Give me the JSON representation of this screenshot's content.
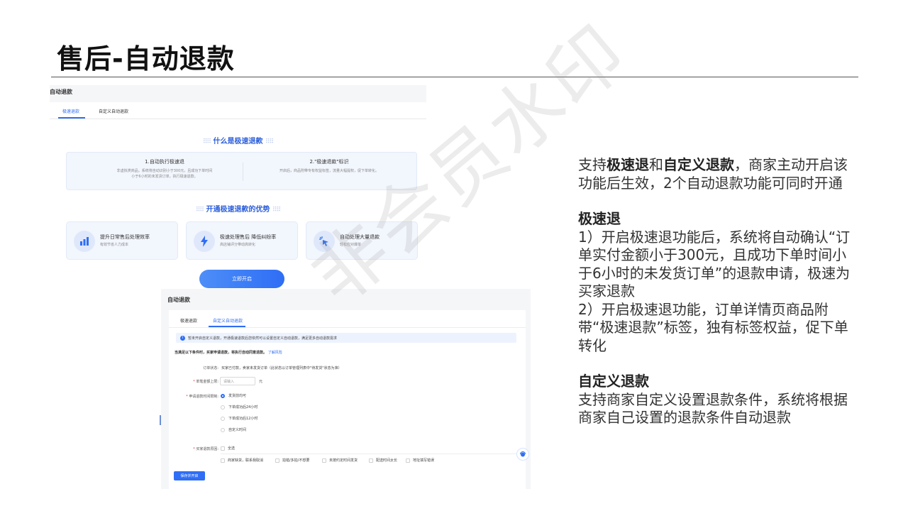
{
  "slide": {
    "title": "售后-自动退款"
  },
  "shot1": {
    "title": "自动退款",
    "tabs": [
      "极速退款",
      "自定义自动退款"
    ],
    "what_is": "什么是极速退款",
    "items": [
      {
        "title": "1.自动执行极速退",
        "desc1": "非虚拟类商品，系统将自动识别小于300元，且成功下单时间",
        "desc2": "小于6小时的未发货订单，执行极速退款。"
      },
      {
        "title": "2.\"极速退款\"标识",
        "desc1": "开启后，商品附带专有权益标签，流量大幅提权，促下单转化。",
        "desc2": ""
      }
    ],
    "advantages_title": "开通极速退款的优势",
    "advantages": [
      {
        "icon": "chart-icon",
        "title": "提升日常售后处理效率",
        "desc": "有效节省人力成本"
      },
      {
        "icon": "lightning-icon",
        "title": "极速处理售后 降低纠纷率",
        "desc": "高店铺评分带动高转化"
      },
      {
        "icon": "cursor-click-icon",
        "title": "自动处理大量退款",
        "desc": "轻松应对爆单"
      }
    ],
    "open_button": "立即开启"
  },
  "shot2": {
    "title": "自动退款",
    "tabs": [
      "极速退款",
      "自定义自动退款"
    ],
    "notice": "暂未开启自定义退款，开通极速退款后您依然可以设置自定义自动退款，满足更多自动退款需求",
    "condition": "当满足以下条件时，买家申请退款，将执行自动同意退款。",
    "condition_link": "了解风险",
    "order_status_label": "订单状态:",
    "order_status_value": "买家已付款，卖家未发货订单（此状态以订单管理列表中\"待发货\"状态为准）",
    "amount_label": "单笔金额上限:",
    "amount_placeholder": "请输入",
    "amount_unit": "元",
    "time_label": "申请退款时间限制:",
    "time_options": [
      "发货前均可",
      "下单成功后24小时",
      "下单成功后12小时",
      "自定义时间"
    ],
    "reason_label": "买家退款原因:",
    "reason_all": "全选",
    "reasons": [
      "商家缺货，联系我取消",
      "拍错/多拍/不想要",
      "未按约定时间发货",
      "配送时间太长",
      "地址填写错误"
    ],
    "save_button": "保存并开启"
  },
  "watermark": "非会员水印",
  "description": {
    "intro": {
      "p1": "支持",
      "b1": "极速退",
      "p2": "和",
      "b2": "自定义退款",
      "p3": "，商家主动开启该功能后生效，2个自动退款功能可同时开通"
    },
    "fast_title": "极速退",
    "fast_point1": "1）开启极速退功能后，系统将自动确认“订单实付金额小于300元，且成功下单时间小于6小时的未发货订单”的退款申请，极速为买家退款",
    "fast_point2": "2）开启极速退功能，订单详情页商品附带“极速退款”标签，独有标签权益，促下单转化",
    "custom_title": "自定义退款",
    "custom_text": "支持商家自定义设置退款条件，系统将根据商家自己设置的退款条件自动退款"
  }
}
